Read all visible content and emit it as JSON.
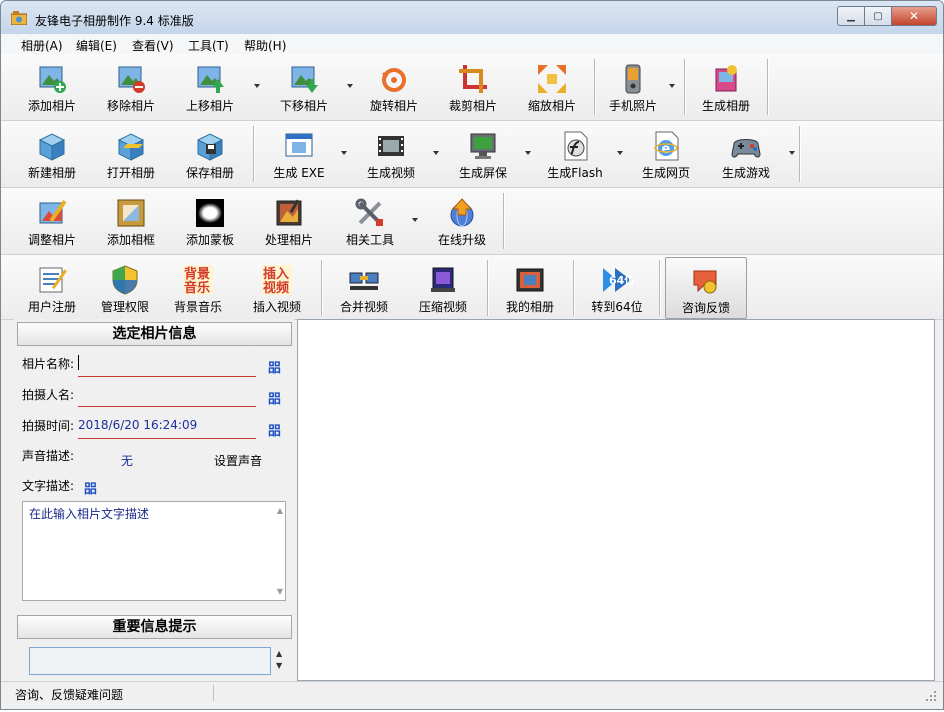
{
  "window": {
    "title": "友锋电子相册制作 9.4 标准版"
  },
  "menu": [
    "相册(A)",
    "编辑(E)",
    "查看(V)",
    "工具(T)",
    "帮助(H)"
  ],
  "toolbar1": [
    "添加相片",
    "移除相片",
    "上移相片",
    "下移相片",
    "旋转相片",
    "裁剪相片",
    "缩放相片",
    "手机照片",
    "生成相册"
  ],
  "toolbar2": [
    "新建相册",
    "打开相册",
    "保存相册",
    "生成 EXE",
    "生成视频",
    "生成屏保",
    "生成Flash",
    "生成网页",
    "生成游戏"
  ],
  "toolbar3": [
    "调整相片",
    "添加相框",
    "添加蒙板",
    "处理相片",
    "相关工具",
    "在线升级"
  ],
  "toolbar4": [
    "用户注册",
    "管理权限",
    "背景音乐",
    "插入视频",
    "合并视频",
    "压缩视频",
    "我的相册",
    "转到64位",
    "咨询反馈"
  ],
  "panel": {
    "title": "选定相片信息",
    "name_label": "相片名称:",
    "name_value": "",
    "photographer_label": "拍摄人名:",
    "photographer_value": "",
    "time_label": "拍摄时间:",
    "time_value": "2018/6/20 16:24:09",
    "sound_label": "声音描述:",
    "sound_value": "无",
    "set_sound": "设置声音",
    "text_label": "文字描述:",
    "text_placeholder": "在此输入相片文字描述",
    "info_title": "重要信息提示"
  },
  "icon_text": {
    "music": "背景\n音乐",
    "video": "插入\n视频",
    "x64": "64位"
  },
  "status": {
    "text": "咨询、反馈疑难问题"
  }
}
